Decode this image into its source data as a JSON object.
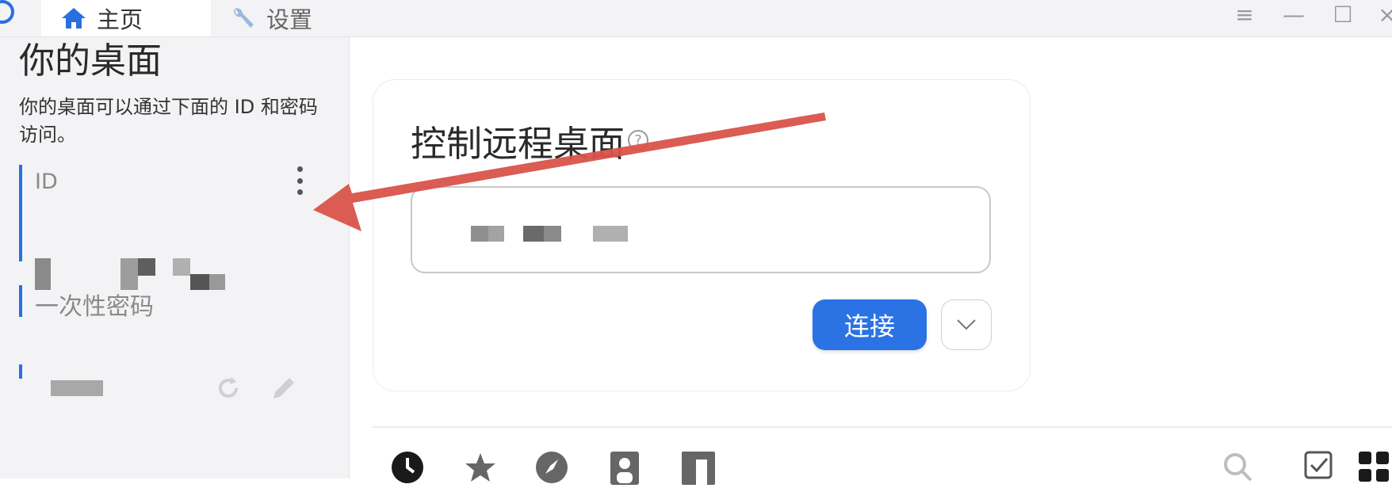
{
  "tabs": [
    {
      "label": "主页",
      "icon": "home-icon"
    },
    {
      "label": "设置",
      "icon": "wrench-icon"
    }
  ],
  "window_controls": {
    "menu": "≡",
    "minimize": "—",
    "maximize": "☐",
    "close": "×"
  },
  "sidebar": {
    "title": "你的桌面",
    "description": "你的桌面可以通过下面的 ID 和密码访问。",
    "id_label": "ID",
    "password_label": "一次性密码"
  },
  "main": {
    "card_title": "控制远程桌面",
    "help": "?",
    "connect_label": "连接"
  },
  "colors": {
    "accent": "#2b73e4",
    "annotation_arrow": "#d9534a"
  }
}
